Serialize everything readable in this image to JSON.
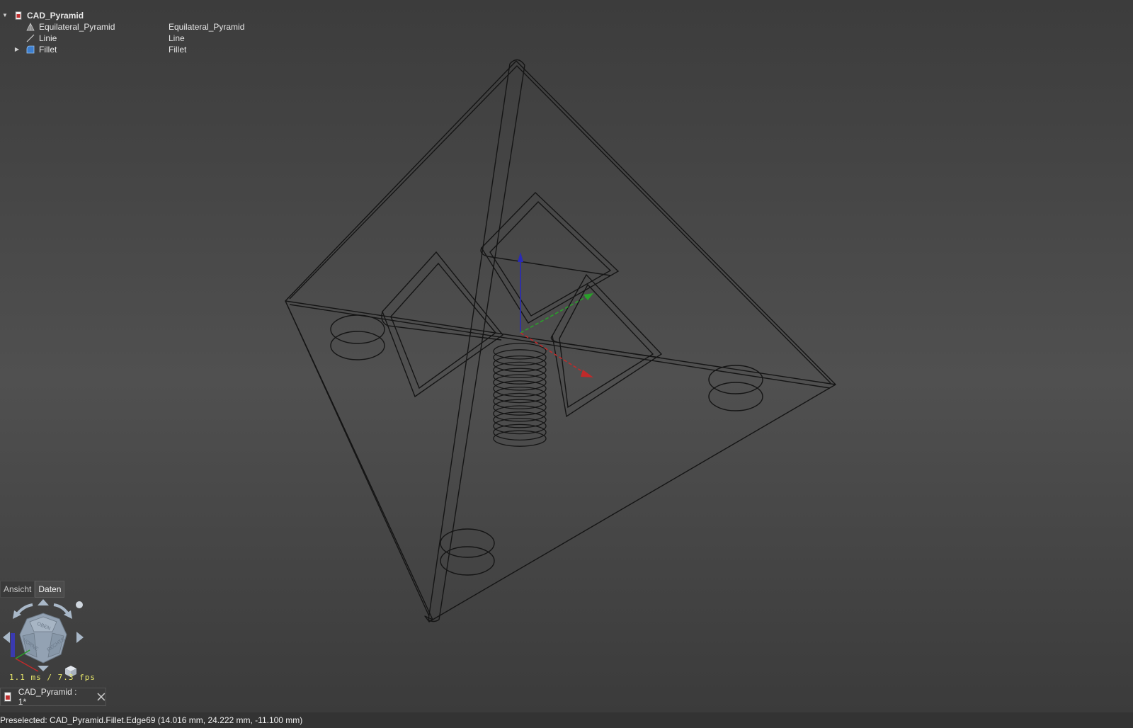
{
  "tree": {
    "root": {
      "label": "CAD_Pyramid",
      "expanded": true,
      "icon": "document-icon"
    },
    "children": [
      {
        "label": "Equilateral_Pyramid",
        "value": "Equilateral_Pyramid",
        "icon": "mesh-icon"
      },
      {
        "label": "Linie",
        "value": "Line",
        "icon": "line-icon"
      },
      {
        "label": "Fillet",
        "value": "Fillet",
        "icon": "fillet-icon",
        "expandable": true
      }
    ]
  },
  "panel_tabs": [
    {
      "label": "Ansicht",
      "active": false
    },
    {
      "label": "Daten",
      "active": true
    }
  ],
  "navcube": {
    "faces": {
      "top": "OBEN",
      "front": "VORNE",
      "right": "RECHTS"
    }
  },
  "fps_readout": "1.1 ms / 7.3 fps",
  "document_tab": {
    "title": "CAD_Pyramid : 1*"
  },
  "status": "Preselected: CAD_Pyramid.Fillet.Edge69 (14.016 mm, 24.222 mm, -11.100 mm)",
  "colors": {
    "wireframe": "#141414",
    "axis_x": "#c12a2a",
    "axis_y": "#2aa02a",
    "axis_z": "#2a2ab8",
    "fps_text": "#e7e76a"
  }
}
